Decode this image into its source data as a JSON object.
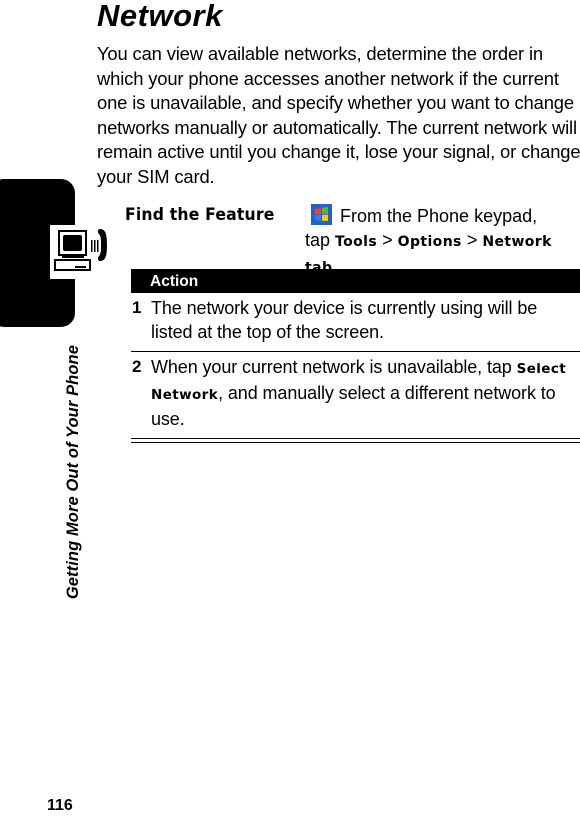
{
  "page": {
    "title": "Network",
    "intro": "You can view available networks, determine the order in which your phone accesses another network if the current one is unavailable, and specify whether you want to change networks manually or automatically. The current network will remain active until you change it, lose your signal, or change your SIM card.",
    "side_label": "Getting More Out of Your Phone",
    "side_icon": "computer-phone-icon",
    "page_number": "116"
  },
  "find_feature": {
    "label": "Find the Feature",
    "icon": "windows-start-icon",
    "text_prefix": "From the Phone keypad,",
    "tap": "tap",
    "path": [
      "Tools",
      "Options",
      "Network tab"
    ],
    "separator": ">"
  },
  "table": {
    "header": "Action",
    "rows": [
      {
        "num": "1",
        "text": "The network your device is currently using will be listed at the top of the screen."
      },
      {
        "num": "2",
        "text_before": "When your current network is unavailable, tap",
        "bold": "Select Network",
        "text_after": ", and manually select a different network to use."
      }
    ]
  }
}
